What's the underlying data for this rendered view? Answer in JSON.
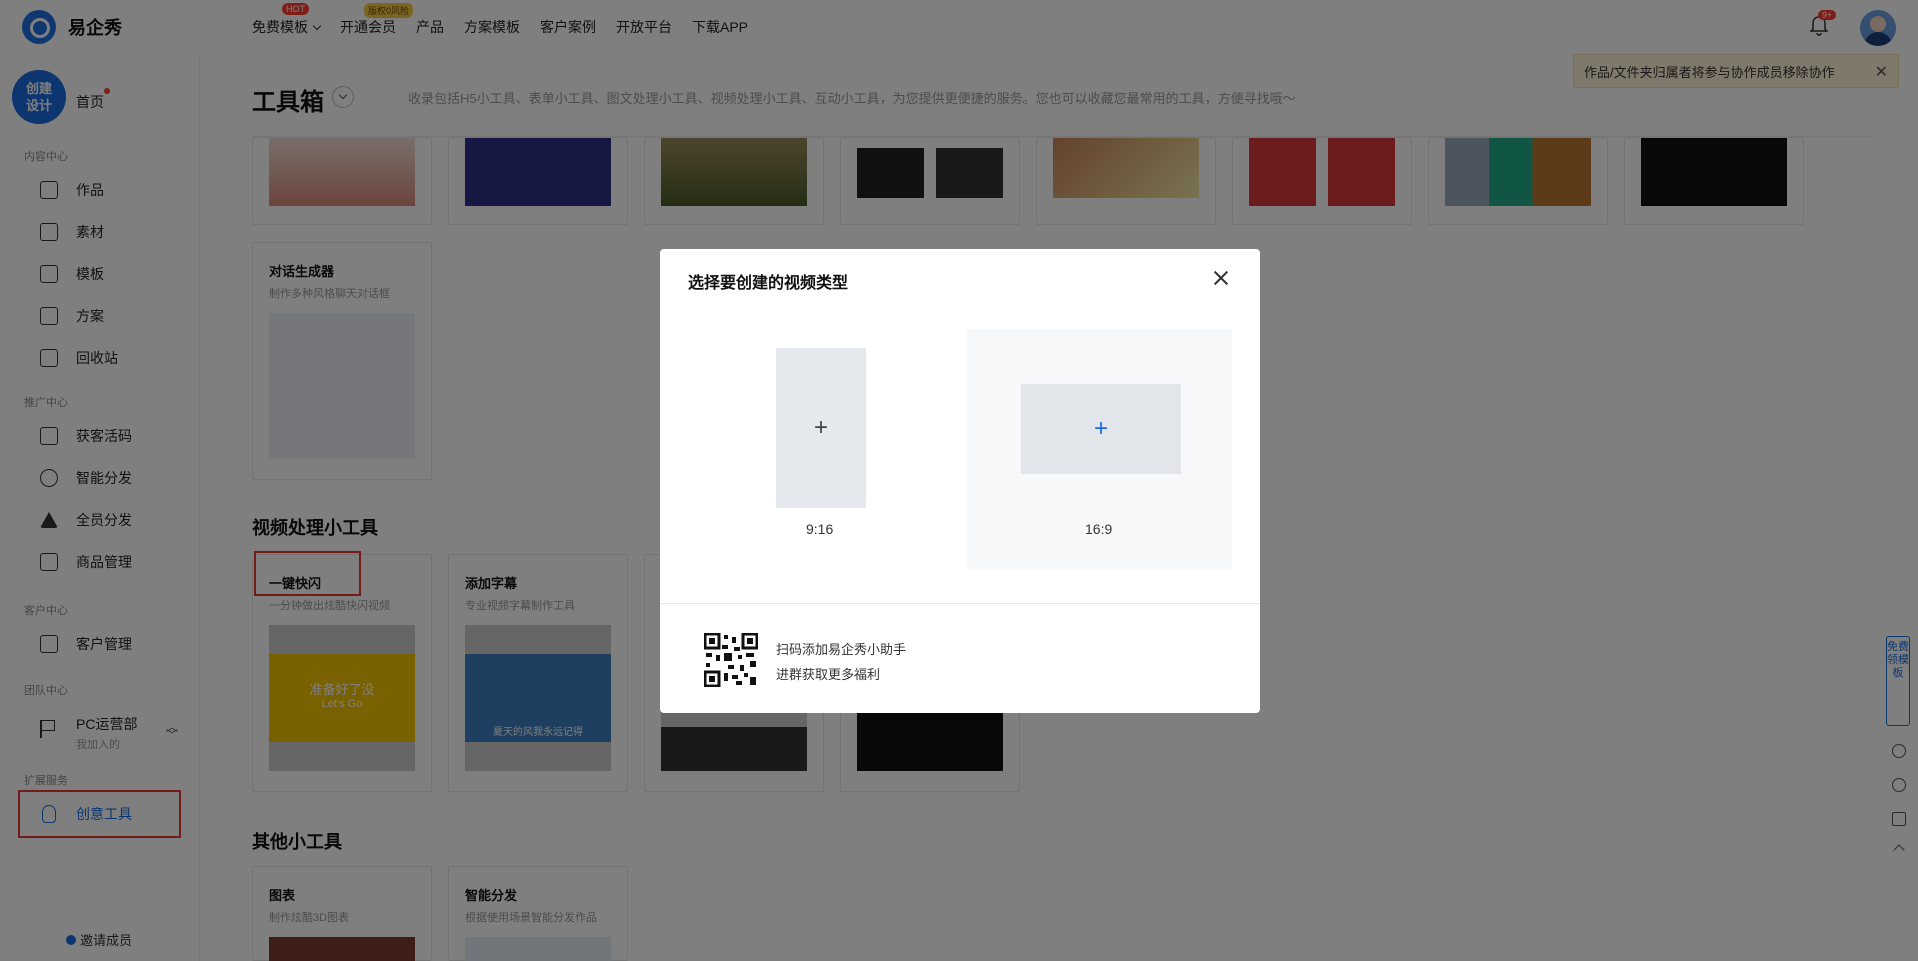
{
  "app": {
    "name": "易企秀"
  },
  "topnav": {
    "items": [
      {
        "label": "免费模板",
        "badge": "HOT"
      },
      {
        "label": "开通会员",
        "badge": "版权0风险"
      },
      {
        "label": "产品"
      },
      {
        "label": "方案模板"
      },
      {
        "label": "客户案例"
      },
      {
        "label": "开放平台"
      },
      {
        "label": "下载APP"
      }
    ],
    "bell_badge": "9+"
  },
  "sidebar": {
    "create_label": "创建设计",
    "home": "首页",
    "sections": {
      "content": "内容中心",
      "promo": "推广中心",
      "customer": "客户中心",
      "team": "团队中心",
      "ext": "扩展服务"
    },
    "items": {
      "works": "作品",
      "materials": "素材",
      "templates": "模板",
      "plans": "方案",
      "recycle": "回收站",
      "qrcode": "获客活码",
      "smart_dist": "智能分发",
      "all_dist": "全员分发",
      "goods": "商品管理",
      "crm": "客户管理",
      "pc_dept": "PC运营部",
      "pc_dept_sub": "我加入的",
      "creative": "创意工具"
    },
    "invite": "邀请成员"
  },
  "notice": {
    "text": "作品/文件夹归属者将参与协作成员移除协作",
    "close": "✕"
  },
  "page": {
    "title": "工具箱",
    "desc": "收录包括H5小工具、表单小工具、图文处理小工具、视频处理小工具、互动小工具，为您提供更便捷的服务。您也可以收藏您最常用的工具，方便寻找哦～"
  },
  "cards_top": {
    "dialog": {
      "title": "对话生成器",
      "desc": "制作多种风格聊天对话框"
    }
  },
  "video_section": {
    "title": "视频处理小工具",
    "cards": [
      {
        "title": "一键快闪",
        "desc": "一分钟做出炫酷快闪视频",
        "thumb_text": "准备好了没",
        "thumb_sub": "Let's Go"
      },
      {
        "title": "添加字幕",
        "desc": "专业视频字幕制作工具",
        "thumb_text": "夏天的风我永远记得"
      }
    ]
  },
  "other_section": {
    "title": "其他小工具",
    "cards": [
      {
        "title": "图表",
        "desc": "制作炫酷3D图表"
      },
      {
        "title": "智能分发",
        "desc": "根据使用场景智能分发作品"
      }
    ]
  },
  "rail": {
    "free_label": "免费领模板"
  },
  "modal": {
    "title": "选择要创建的视频类型",
    "options": [
      {
        "ratio": "9:16",
        "plus": "+"
      },
      {
        "ratio": "16:9",
        "plus": "+"
      }
    ],
    "qr_line1": "扫码添加易企秀小助手",
    "qr_line2": "进群获取更多福利"
  },
  "colors": {
    "accent": "#1a6de0",
    "highlight": "#e53935"
  }
}
